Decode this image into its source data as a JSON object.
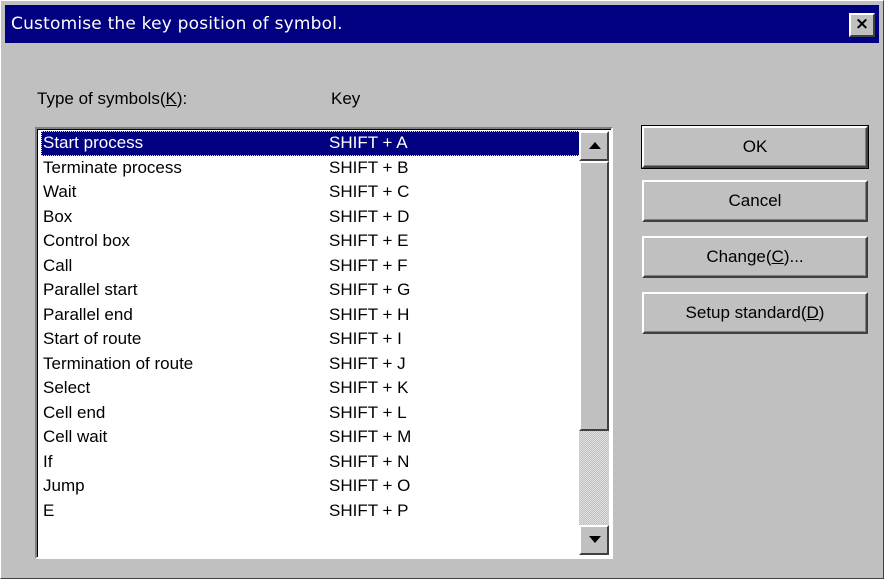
{
  "window": {
    "title": "Customise the key position of symbol.",
    "close_glyph": "×"
  },
  "labels": {
    "symbols_prefix": "Type of symbols(",
    "symbols_mnemonic": "K",
    "symbols_suffix": "):",
    "key_header": "Key"
  },
  "list": {
    "selected_index": 0,
    "rows": [
      {
        "name": "Start process",
        "key": "SHIFT + A"
      },
      {
        "name": "Terminate process",
        "key": "SHIFT + B"
      },
      {
        "name": "Wait",
        "key": "SHIFT + C"
      },
      {
        "name": "Box",
        "key": "SHIFT + D"
      },
      {
        "name": "Control box",
        "key": "SHIFT + E"
      },
      {
        "name": "Call",
        "key": "SHIFT + F"
      },
      {
        "name": "Parallel start",
        "key": "SHIFT + G"
      },
      {
        "name": "Parallel end",
        "key": "SHIFT + H"
      },
      {
        "name": "Start of route",
        "key": "SHIFT + I"
      },
      {
        "name": "Termination of route",
        "key": "SHIFT + J"
      },
      {
        "name": "Select",
        "key": "SHIFT + K"
      },
      {
        "name": "Cell end",
        "key": "SHIFT + L"
      },
      {
        "name": "Cell wait",
        "key": "SHIFT + M"
      },
      {
        "name": "If",
        "key": "SHIFT + N"
      },
      {
        "name": "Jump",
        "key": "SHIFT + O"
      },
      {
        "name": "E",
        "key": "SHIFT + P"
      }
    ]
  },
  "buttons": {
    "ok": "OK",
    "cancel": "Cancel",
    "change_prefix": "Change(",
    "change_mnemonic": "C",
    "change_suffix": ")...",
    "setup_prefix": "Setup standard(",
    "setup_mnemonic": "D",
    "setup_suffix": ")"
  },
  "colors": {
    "title_bar": "#000080",
    "selection": "#000080",
    "face": "#c0c0c0"
  }
}
